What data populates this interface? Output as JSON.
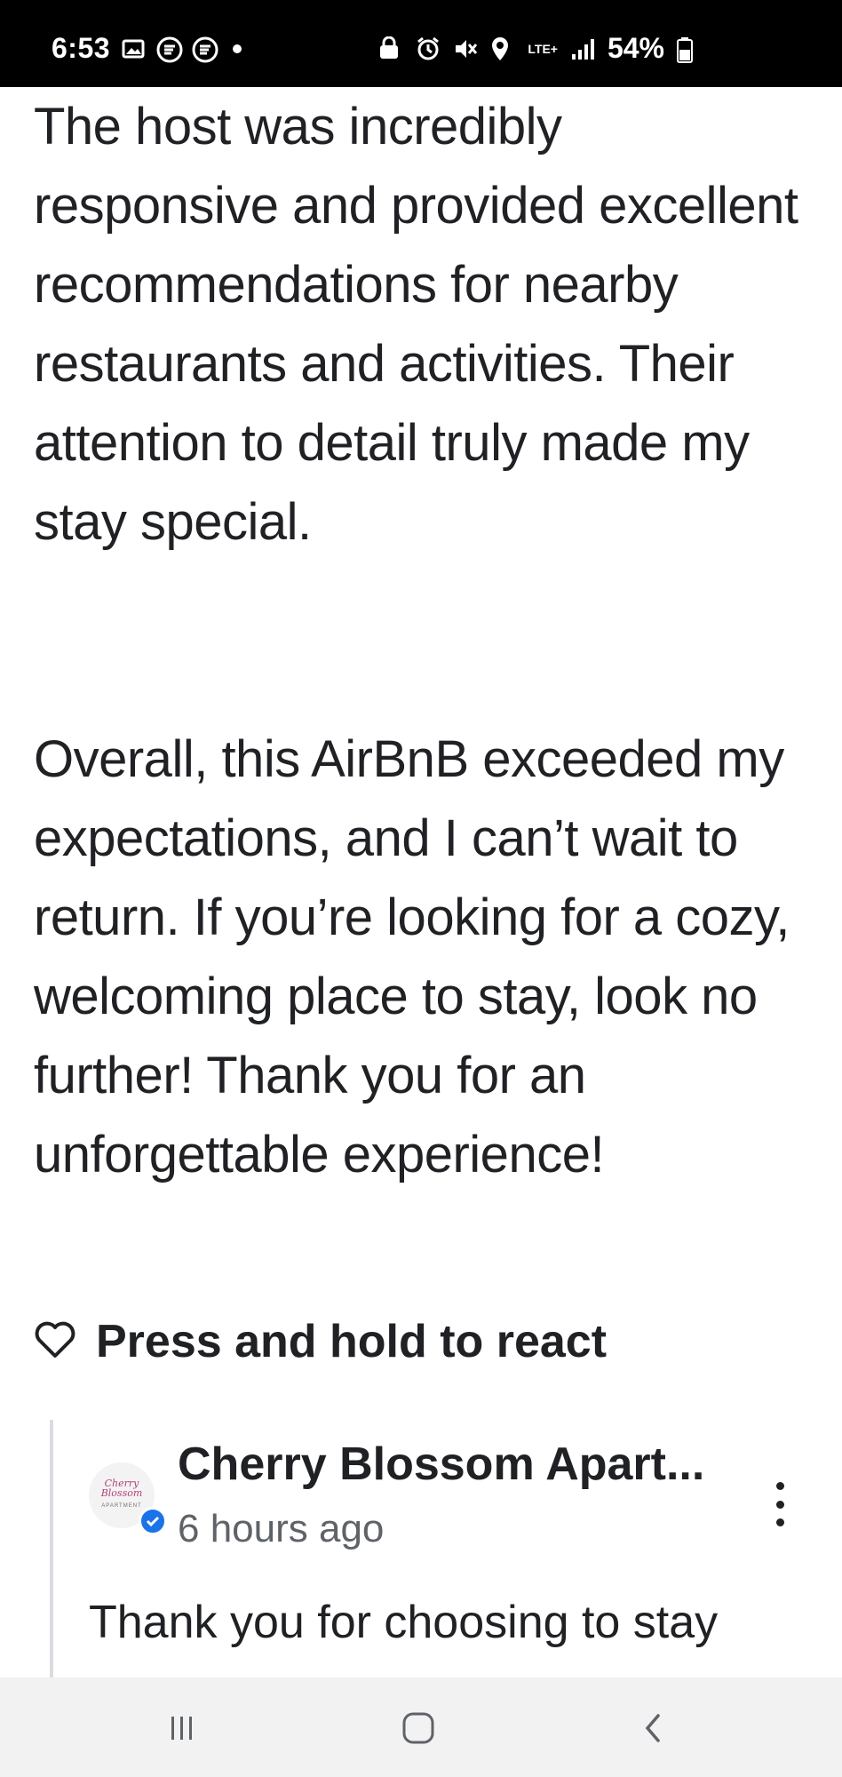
{
  "status_bar": {
    "time": "6:53",
    "battery": "54%",
    "network": "LTE+"
  },
  "review": {
    "paragraph_1": "The host was incredibly responsive and provided excellent recommendations for nearby restaurants and activities. Their attention to detail truly made my stay special.",
    "paragraph_2": "Overall, this AirBnB exceeded my expectations, and I can’t wait to return. If you’re looking for a cozy, welcoming place to stay, look no further! Thank you for an unforgettable experience!"
  },
  "react": {
    "label": "Press and hold to react",
    "icon": "heart-outline-icon"
  },
  "reply": {
    "name": "Cherry Blossom Apart...",
    "time": "6 hours ago",
    "text": "Thank you for choosing to stay",
    "avatar_text": "Cherry Blossom",
    "avatar_sub": "APARTMENT",
    "verified_color": "#1a73e8"
  },
  "nav": {
    "recents_icon": "recents-icon",
    "home_icon": "home-icon",
    "back_icon": "back-icon"
  }
}
